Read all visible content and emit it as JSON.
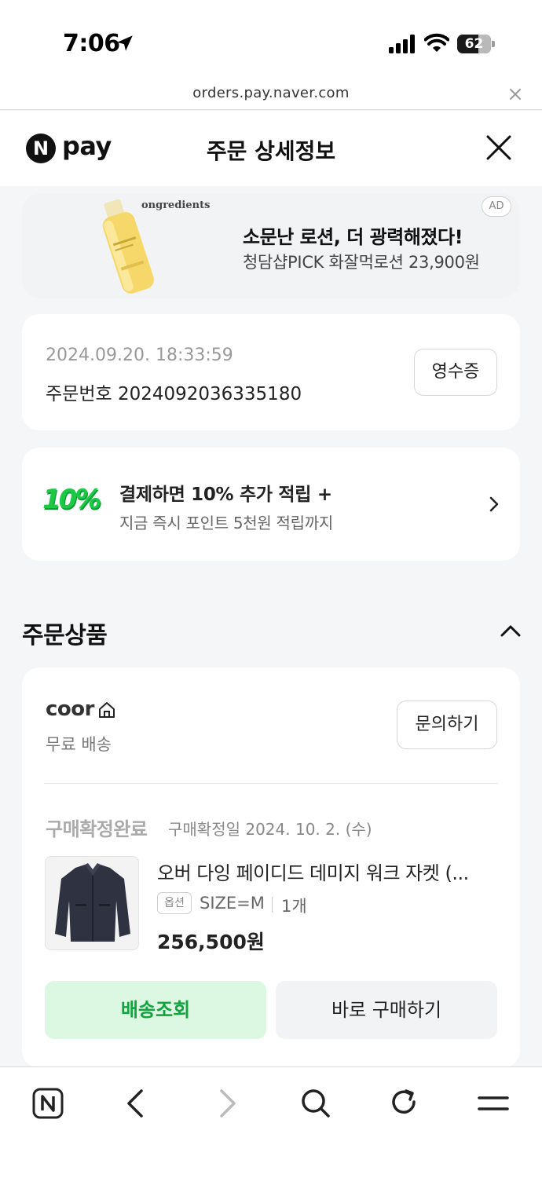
{
  "status_bar": {
    "time": "7:06",
    "battery": "62",
    "battery_level": 0.62
  },
  "browser": {
    "url": "orders.pay.naver.com"
  },
  "header": {
    "logo_badge": "N",
    "logo_text": "pay",
    "title": "주문 상세정보"
  },
  "ad": {
    "brand": "ongredients",
    "headline": "소문난 로션, 더 광력해졌다!",
    "subtext": "청담샵PICK 화잘먹로션 23,900원",
    "tag": "AD"
  },
  "order": {
    "date": "2024.09.20. 18:33:59",
    "number_label": "주문번호 2024092036335180",
    "receipt_label": "영수증"
  },
  "point_promo": {
    "badge": "10%",
    "title": "결제하면 10% 추가 적립 +",
    "subtitle": "지금 즉시 포인트 5천원 적립까지"
  },
  "section": {
    "title": "주문상품"
  },
  "product": {
    "shop": "coor",
    "shipping": "무료 배송",
    "inquiry_label": "문의하기",
    "status": "구매확정완료",
    "confirm_date": "구매확정일 2024. 10. 2. (수)",
    "name": "오버 다잉 페이디드 데미지 워크 자켓 (...",
    "option_badge": "옵션",
    "option_value": "SIZE=M",
    "quantity": "1개",
    "price": "256,500원",
    "track_label": "배송조회",
    "buy_label": "바로 구매하기"
  },
  "toolbar": {
    "items": [
      "naver-home-icon",
      "back-icon",
      "forward-icon",
      "search-icon",
      "refresh-icon",
      "menu-icon"
    ]
  },
  "colors": {
    "accent_green": "#12a33e",
    "track_bg": "#dcf8e3",
    "promo_green": "#1bc946"
  }
}
